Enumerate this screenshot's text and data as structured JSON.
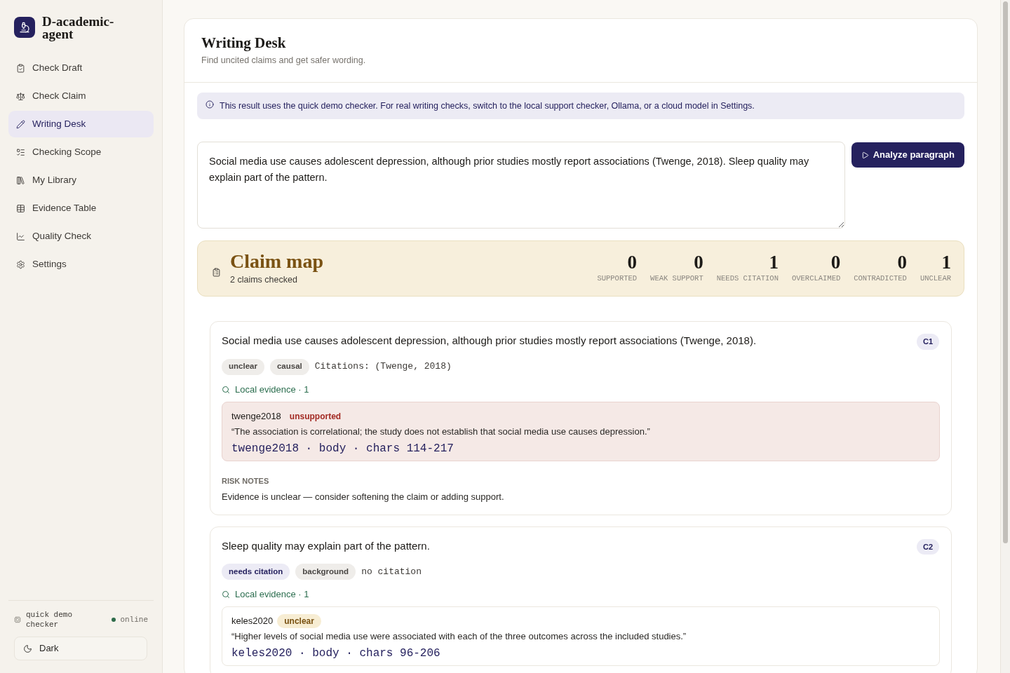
{
  "sidebar": {
    "brand": "D-academic-agent",
    "items": [
      {
        "label": "Check Draft",
        "selected": false
      },
      {
        "label": "Check Claim",
        "selected": false
      },
      {
        "label": "Writing Desk",
        "selected": true
      },
      {
        "label": "Checking Scope",
        "selected": false
      },
      {
        "label": "My Library",
        "selected": false
      },
      {
        "label": "Evidence Table",
        "selected": false
      },
      {
        "label": "Quality Check",
        "selected": false
      },
      {
        "label": "Settings",
        "selected": false
      }
    ],
    "engine": "quick demo checker",
    "status": "online",
    "theme_button": "Dark"
  },
  "page": {
    "title": "Writing Desk",
    "subtitle": "Find uncited claims and get safer wording."
  },
  "notice": "This result uses the quick demo checker. For real writing checks, switch to the local support checker, Ollama, or a cloud model in Settings.",
  "paragraph": {
    "value": "Social media use causes adolescent depression, although prior studies mostly report associations (Twenge, 2018). Sleep quality may explain part of the pattern."
  },
  "analyze_button": "Analyze paragraph",
  "claim_map": {
    "title": "Claim map",
    "summary": "2 claims checked",
    "stats": [
      {
        "value": "0",
        "label": "SUPPORTED"
      },
      {
        "value": "0",
        "label": "WEAK SUPPORT"
      },
      {
        "value": "1",
        "label": "NEEDS CITATION"
      },
      {
        "value": "0",
        "label": "OVERCLAIMED"
      },
      {
        "value": "0",
        "label": "CONTRADICTED"
      },
      {
        "value": "1",
        "label": "UNCLEAR"
      }
    ]
  },
  "claims": [
    {
      "text": "Social media use causes adolescent depression, although prior studies mostly report associations (Twenge, 2018).",
      "badge": "C1",
      "tags": [
        {
          "label": "unclear",
          "kind": "plain"
        },
        {
          "label": "causal",
          "kind": "plain"
        }
      ],
      "citations": "Citations: (Twenge, 2018)",
      "evidence_heading": "Local evidence · 1",
      "evidence": [
        {
          "source": "twenge2018",
          "verdict": "unsupported",
          "kind": "danger",
          "quote": "“The association is correlational; the study does not establish that social media use causes depression.”",
          "location": "twenge2018 · body · chars 114-217"
        }
      ],
      "risk_heading": "RISK NOTES",
      "risk_note": "Evidence is unclear — consider softening the claim or adding support."
    },
    {
      "text": "Sleep quality may explain part of the pattern.",
      "badge": "C2",
      "tags": [
        {
          "label": "needs citation",
          "kind": "accent"
        },
        {
          "label": "background",
          "kind": "plain"
        }
      ],
      "citations": "no citation",
      "evidence_heading": "Local evidence · 1",
      "evidence": [
        {
          "source": "keles2020",
          "verdict": "unclear",
          "kind": "warning",
          "quote": "“Higher levels of social media use were associated with each of the three outcomes across the included studies.”",
          "location": "keles2020 · body · chars 96-206"
        }
      ]
    }
  ]
}
